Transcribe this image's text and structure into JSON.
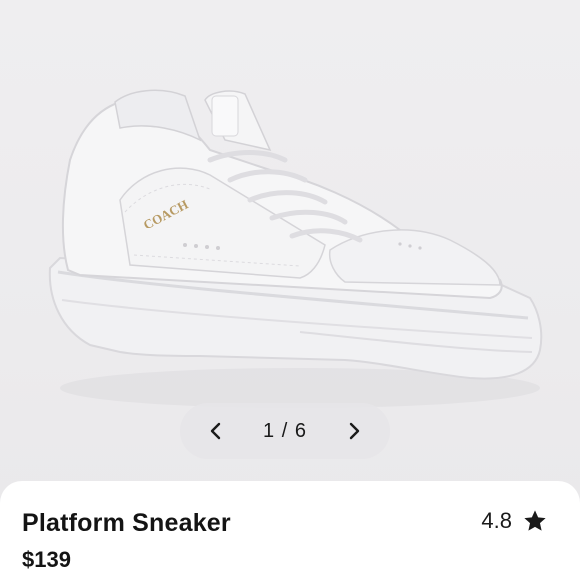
{
  "gallery": {
    "image_alt": "White platform sneaker",
    "brand_mark": "COACH",
    "current_index": "1",
    "total": "6",
    "counter_text": "1 / 6",
    "prev_icon": "chevron-left-icon",
    "next_icon": "chevron-right-icon"
  },
  "product": {
    "name": "Platform Sneaker",
    "price": "$139",
    "rating": "4.8",
    "rating_icon": "star-icon"
  },
  "colors": {
    "background": "#eeedef",
    "card": "#ffffff",
    "text": "#141414",
    "shoe": "#f4f4f5",
    "logo": "#b79a63"
  }
}
